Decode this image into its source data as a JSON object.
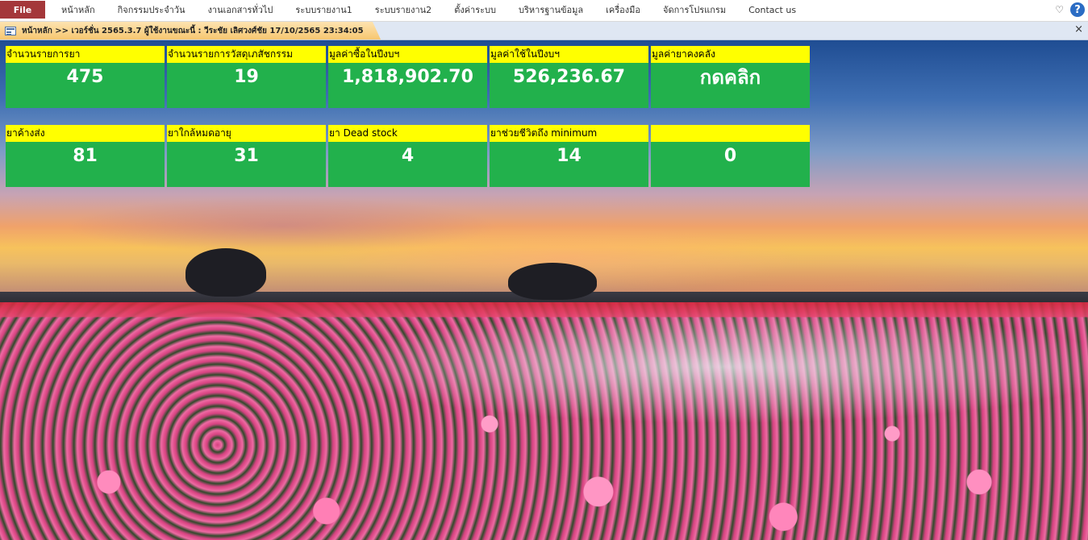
{
  "ribbon": {
    "file_label": "File",
    "menu": [
      "หน้าหลัก",
      "กิจกรรมประจำวัน",
      "งานเอกสารทั่วไป",
      "ระบบรายงาน1",
      "ระบบรายงาน2",
      "ตั้งค่าระบบ",
      "บริหารฐานข้อมูล",
      "เครื่องมือ",
      "จัดการโปรแกรม",
      "Contact us"
    ],
    "help_label": "?"
  },
  "document_tab": {
    "title": "หน้าหลัก >> เวอร์ชั่น 2565.3.7 ผู้ใช้งานขณะนี้ : วีระชัย เลิศวงศ์ชัย 17/10/2565 23:34:05",
    "close_label": "×"
  },
  "tiles": [
    {
      "label": "จำนวนรายการยา",
      "value": "475"
    },
    {
      "label": "จำนวนรายการวัสดุเภสัชกรรม",
      "value": "19"
    },
    {
      "label": "มูลค่าซื้อในปีงบฯ",
      "value": "1,818,902.70"
    },
    {
      "label": "มูลค่าใช้ในปีงบฯ",
      "value": "526,236.67"
    },
    {
      "label": "มูลค่ายาคงคลัง",
      "value": "กดคลิก"
    },
    {
      "label": "ยาค้างส่ง",
      "value": "81"
    },
    {
      "label": "ยาใกล้หมดอายุ",
      "value": "31"
    },
    {
      "label": "ยา Dead stock",
      "value": "4"
    },
    {
      "label": "ยาช่วยชีวิตถึง minimum",
      "value": "14"
    },
    {
      "label": "",
      "value": "0"
    }
  ]
}
